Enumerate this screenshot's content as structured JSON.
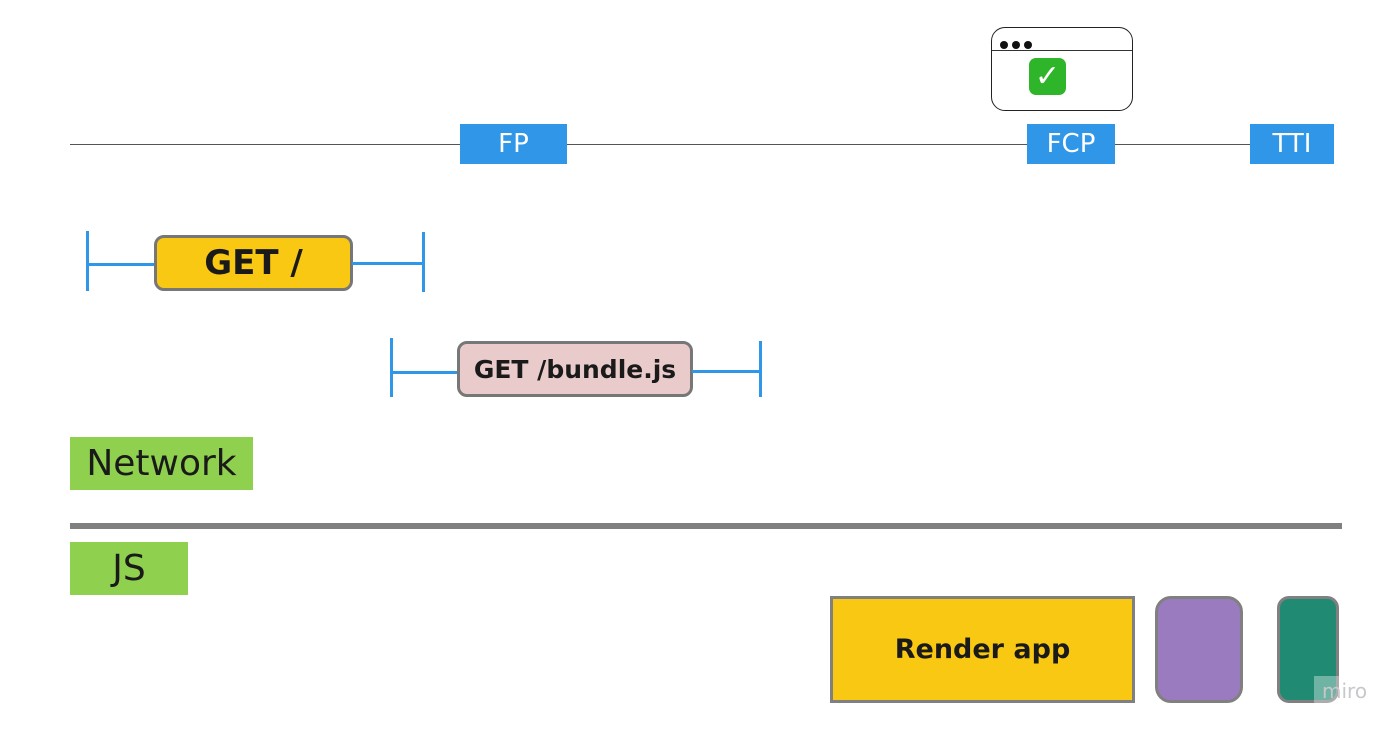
{
  "timeline": {
    "markers": [
      {
        "label": "FP"
      },
      {
        "label": "FCP"
      },
      {
        "label": "TTI"
      }
    ],
    "browser_window": {
      "icon": "check-mark-icon",
      "check_color": "#2fb52a"
    }
  },
  "network": {
    "requests": [
      {
        "label": "GET /",
        "color": "#f8c813"
      },
      {
        "label": "GET /bundle.js",
        "color": "#eacbcb"
      }
    ],
    "lane_label": "Network"
  },
  "js": {
    "lane_label": "JS",
    "tasks": [
      {
        "label": "Render app",
        "color": "#f8c813"
      },
      {
        "label": "",
        "color": "#9a7bbf"
      },
      {
        "label": "",
        "color": "#218a73"
      }
    ]
  },
  "colors": {
    "marker": "#2f96e8",
    "lane": "#8fd14f",
    "divider": "#808080"
  },
  "watermark": "miro"
}
